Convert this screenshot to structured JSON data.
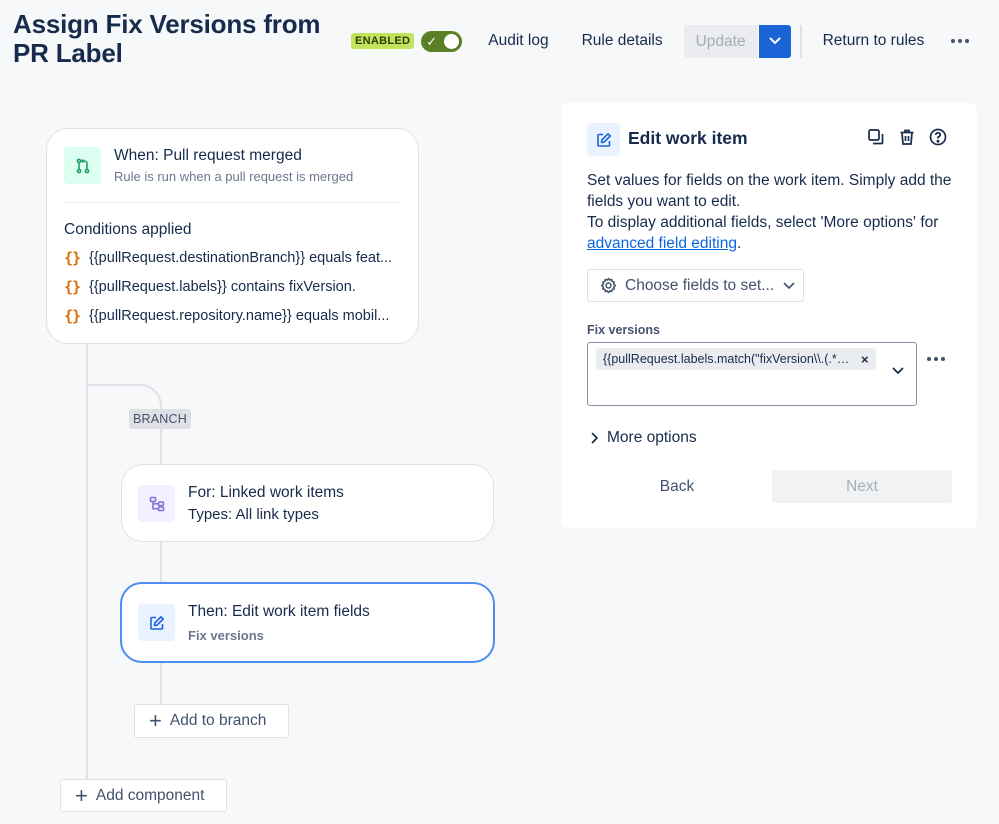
{
  "page": {
    "title": "Assign Fix Versions from PR Label"
  },
  "header": {
    "status_badge": "ENABLED",
    "audit_log": "Audit log",
    "rule_details": "Rule details",
    "update": "Update",
    "return_to_rules": "Return to rules"
  },
  "trigger": {
    "title": "When: Pull request merged",
    "subtitle": "Rule is run when a pull request is merged",
    "conditions_heading": "Conditions applied",
    "conditions": [
      {
        "icon": "{}",
        "text": "{{pullRequest.destinationBranch}} equals feat..."
      },
      {
        "icon": "{}",
        "text": "{{pullRequest.labels}} contains fixVersion."
      },
      {
        "icon": "{}",
        "text": "{{pullRequest.repository.name}} equals mobil..."
      }
    ]
  },
  "branch": {
    "label": "BRANCH",
    "linked": {
      "title": "For: Linked work items",
      "subtitle": "Types: All link types"
    },
    "edit": {
      "title": "Then: Edit work item fields",
      "subtitle": "Fix versions"
    },
    "add_to_branch": "Add to branch"
  },
  "add_component": "Add component",
  "panel": {
    "title": "Edit work item",
    "desc_line1": "Set values for fields on the work item. Simply add the fields you want to edit.",
    "desc_line2": "To display additional fields, select 'More options' for",
    "desc_link": "advanced field editing",
    "desc_end": ".",
    "choose_fields": "Choose fields to set...",
    "fix_versions_label": "Fix versions",
    "fix_versions_value": "{{pullRequest.labels.match(\"fixVersion\\\\.(.*)\")}}",
    "more_options": "More options",
    "back": "Back",
    "next": "Next"
  },
  "colors": {
    "accent": "#1d63d8",
    "enabled_badge": "#c3e35d",
    "toggle_on": "#5b7f24",
    "selected_border": "#4c8ff0",
    "condition_brace": "#d97008"
  }
}
